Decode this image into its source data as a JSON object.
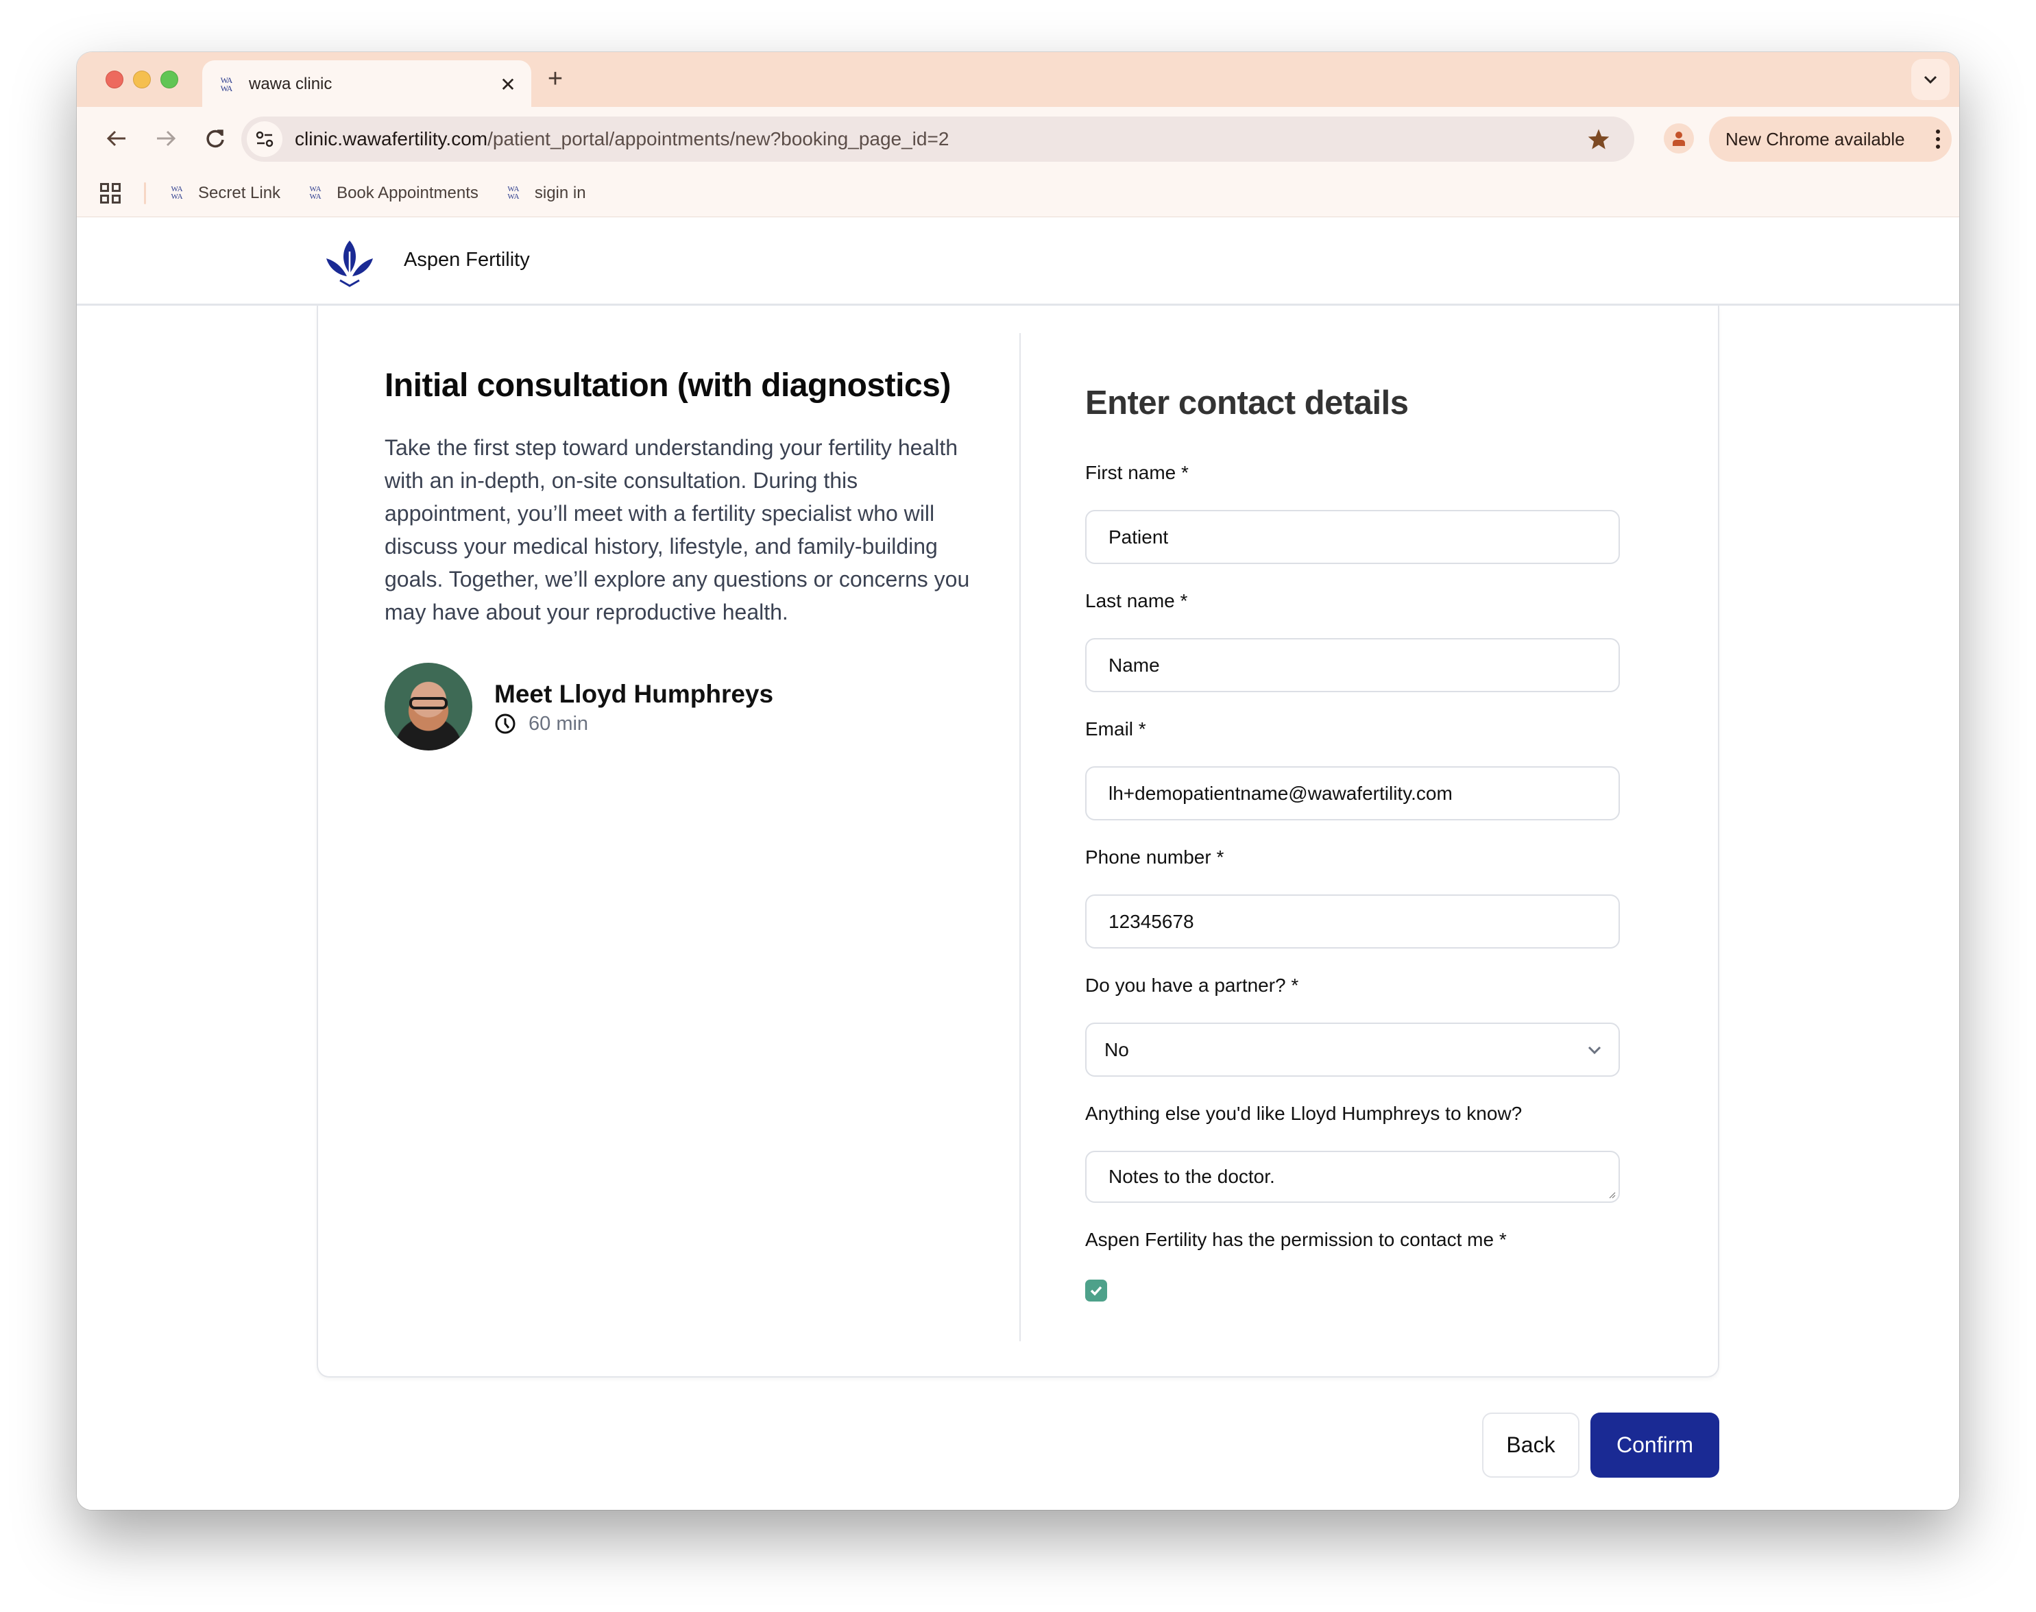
{
  "browser": {
    "tab": {
      "title": "wawa clinic",
      "favicon": "WA\nWA"
    },
    "url": {
      "host": "clinic.wawafertility.com",
      "path": "/patient_portal/appointments/new?booking_page_id=2"
    },
    "update_button": "New Chrome available",
    "bookmarks": [
      {
        "label": "Secret Link"
      },
      {
        "label": "Book Appointments"
      },
      {
        "label": "sigin in"
      }
    ],
    "favicon_text": "WA"
  },
  "site": {
    "name": "Aspen Fertility",
    "brand_color": "#1a2a94"
  },
  "appointment": {
    "title": "Initial consultation (with diagnostics)",
    "description": "Take the first step toward understanding your fertility health with an in-depth, on-site consultation. During this appointment, you’ll meet with a fertility specialist who will discuss your medical history, lifestyle, and family-building goals. Together, we’ll explore any questions or concerns you may have about your reproductive health.",
    "provider": "Meet Lloyd Humphreys",
    "duration": "60 min"
  },
  "form": {
    "title": "Enter contact details",
    "fields": {
      "first_name": {
        "label": "First name",
        "required": "*",
        "value": "Patient"
      },
      "last_name": {
        "label": "Last name",
        "required": "*",
        "value": "Name"
      },
      "email": {
        "label": "Email",
        "required": "*",
        "value": "lh+demopatientname@wawafertility.com"
      },
      "phone": {
        "label": "Phone number",
        "required": "*",
        "value": "12345678"
      },
      "partner": {
        "label": "Do you have a partner?",
        "required": "*",
        "value": "No"
      },
      "notes": {
        "label": "Anything else you'd like Lloyd Humphreys to know?",
        "value": "Notes to the doctor."
      },
      "consent": {
        "label": "Aspen Fertility has the permission to contact me",
        "required": "*",
        "checked": true,
        "color": "#4ea18a"
      }
    }
  },
  "actions": {
    "back": "Back",
    "confirm": "Confirm"
  }
}
